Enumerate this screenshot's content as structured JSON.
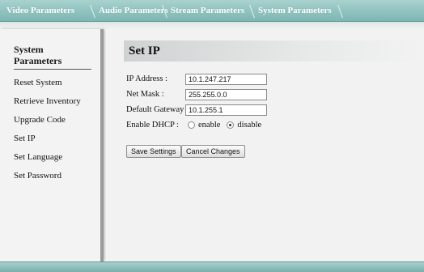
{
  "tabs": {
    "video": "Video Parameters",
    "audio": "Audio Parameters",
    "stream": "Stream Parameters",
    "system": "System Parameters"
  },
  "sidebar": {
    "title": "System Parameters",
    "items": [
      {
        "label": "Reset System"
      },
      {
        "label": "Retrieve Inventory"
      },
      {
        "label": "Upgrade Code"
      },
      {
        "label": "Set IP"
      },
      {
        "label": "Set Language"
      },
      {
        "label": "Set Password"
      }
    ]
  },
  "page": {
    "title": "Set IP"
  },
  "form": {
    "ip_label": "IP Address :",
    "ip_value": "10.1.247.217",
    "mask_label": "Net Mask :",
    "mask_value": "255.255.0.0",
    "gateway_label": "Default Gateway :",
    "gateway_value": "10.1.255.1",
    "dhcp_label": "Enable DHCP :",
    "dhcp_enable": "enable",
    "dhcp_disable": "disable",
    "dhcp_selected": "disable"
  },
  "buttons": {
    "save": "Save Settings",
    "cancel": "Cancel Changes"
  },
  "colors": {
    "tab_bar": "#8fc2bf",
    "sidebar_bg": "#f3f3f3",
    "content_bg": "#f2f2f2"
  }
}
